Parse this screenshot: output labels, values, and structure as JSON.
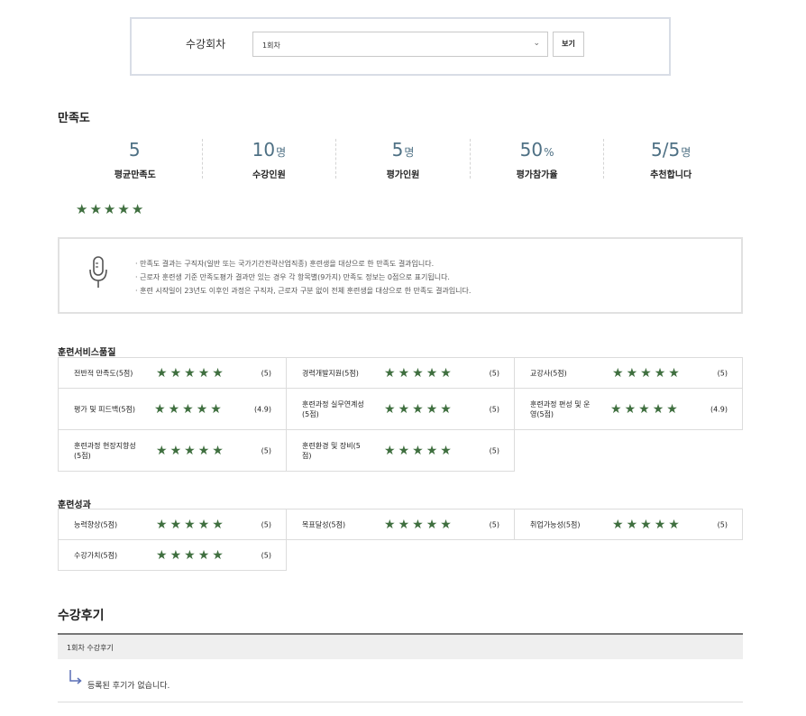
{
  "filter": {
    "label": "수강회차",
    "selected": "1회차",
    "button": "보기"
  },
  "satisfaction": {
    "title": "만족도",
    "stats": [
      {
        "value": "5",
        "unit": "",
        "label": "평균만족도"
      },
      {
        "value": "10",
        "unit": "명",
        "label": "수강인원"
      },
      {
        "value": "5",
        "unit": "명",
        "label": "평가인원"
      },
      {
        "value": "50",
        "unit": "%",
        "label": "평가참가율"
      },
      {
        "value": "5/5",
        "unit": "명",
        "label": "추천합니다"
      }
    ],
    "stars": 5,
    "notices": [
      "만족도 결과는 구직자(일반 또는 국가기간전략산업직종) 훈련생을 대상으로 한 만족도 결과입니다.",
      "근로자 훈련생 기준 만족도평가 결과만 있는 경우 각 항목별(9가지) 만족도 정보는 0점으로 표기됩니다.",
      "훈련 시작일이 23년도 이후인 과정은 구직자, 근로자 구분 없이 전체 훈련생을 대상으로 한 만족도 결과입니다."
    ]
  },
  "service_quality": {
    "title": "훈련서비스품질",
    "items": [
      {
        "label": "전반적 만족도(5점)",
        "score": "(5)"
      },
      {
        "label": "경력개발지원(5점)",
        "score": "(5)"
      },
      {
        "label": "교강사(5점)",
        "score": "(5)"
      },
      {
        "label": "평가 및 피드백(5점)",
        "score": "(4.9)"
      },
      {
        "label": "훈련과정 실무연계성(5점)",
        "score": "(5)"
      },
      {
        "label": "훈련과정 편성 및 운영(5점)",
        "score": "(4.9)"
      },
      {
        "label": "훈련과정 현장지향성(5점)",
        "score": "(5)"
      },
      {
        "label": "훈련환경 및 장비(5점)",
        "score": "(5)"
      }
    ]
  },
  "outcome": {
    "title": "훈련성과",
    "items": [
      {
        "label": "능력향상(5점)",
        "score": "(5)"
      },
      {
        "label": "목표달성(5점)",
        "score": "(5)"
      },
      {
        "label": "취업가능성(5점)",
        "score": "(5)"
      },
      {
        "label": "수강가치(5점)",
        "score": "(5)"
      }
    ]
  },
  "reviews": {
    "title": "수강후기",
    "session_header": "1회차 수강후기",
    "empty_text": "등록된 후기가 없습니다."
  },
  "colors": {
    "star": "#3f6f3f",
    "stat_value": "#4e7084"
  },
  "icons": {
    "notice": "microphone-icon",
    "reply": "reply-arrow-icon",
    "select": "chevron-down-icon"
  }
}
